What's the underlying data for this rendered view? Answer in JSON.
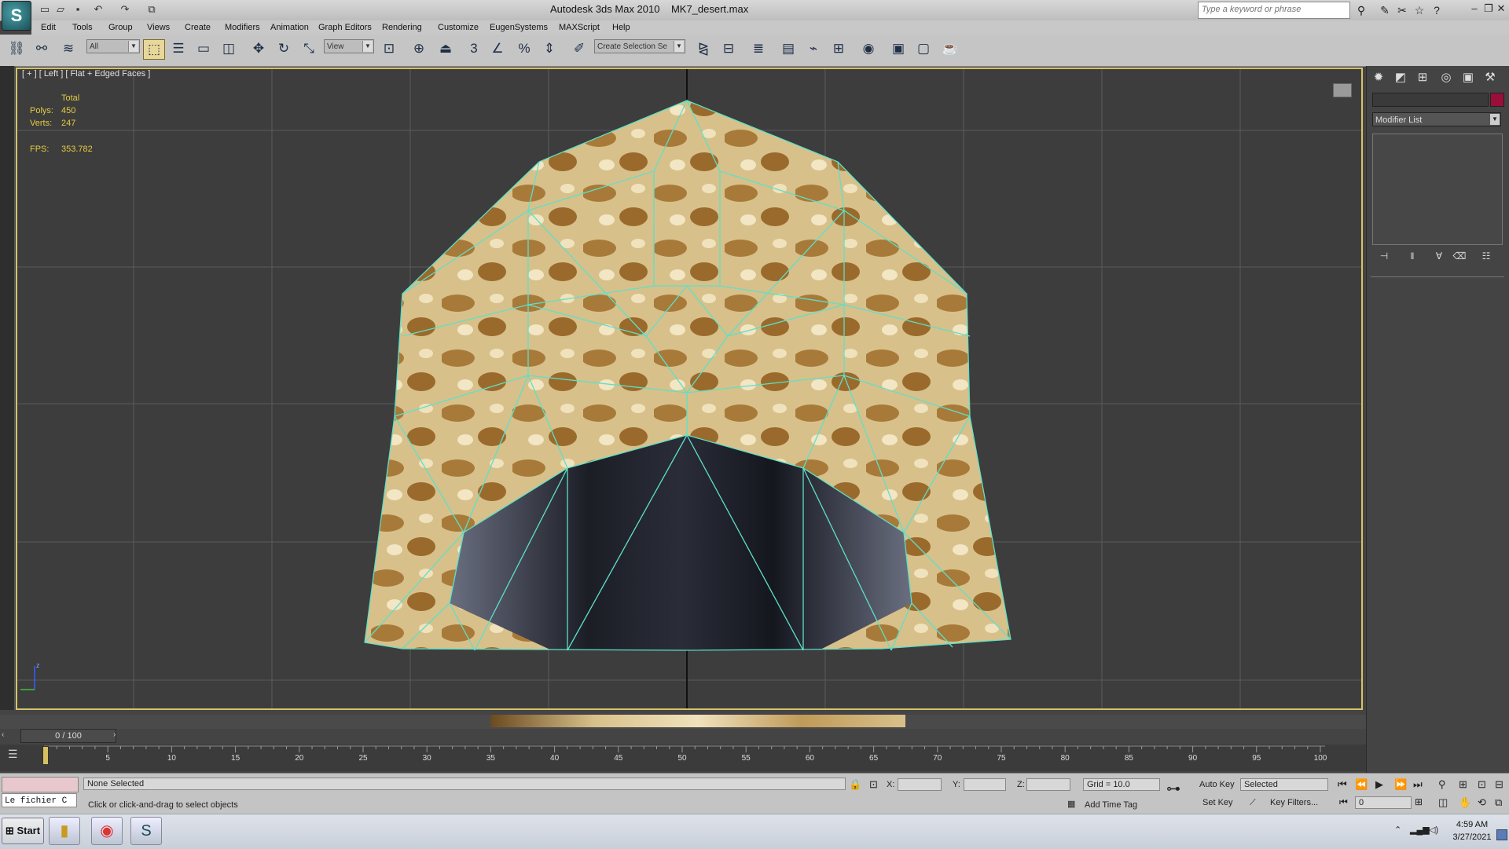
{
  "titlebar": {
    "app_name": "Autodesk 3ds Max  2010",
    "file_name": "MK7_desert.max",
    "search_placeholder": "Type a keyword or phrase"
  },
  "menu": [
    "Edit",
    "Tools",
    "Group",
    "Views",
    "Create",
    "Modifiers",
    "Animation",
    "Graph Editors",
    "Rendering",
    "Customize",
    "EugenSystems",
    "MAXScript",
    "Help"
  ],
  "toolbar": {
    "selection_filter": "All",
    "ref_coord": "View",
    "named_selection": "Create Selection Se",
    "snap_label": "3"
  },
  "viewport": {
    "label": "[ + ] [ Left ] [ Flat + Edged Faces ]",
    "stats_header": "Total",
    "polys_label": "Polys:",
    "polys_value": "450",
    "verts_label": "Verts:",
    "verts_value": "247",
    "fps_label": "FPS:",
    "fps_value": "353.782",
    "axis_z": "z"
  },
  "command_panel": {
    "modifier_list": "Modifier List",
    "object_color": "#9a0e3a"
  },
  "timeline": {
    "time_slider": "0 / 100",
    "ticks": [
      "5",
      "10",
      "15",
      "20",
      "25",
      "30",
      "35",
      "40",
      "45",
      "50",
      "55",
      "60",
      "65",
      "70",
      "75",
      "80",
      "85",
      "90",
      "95",
      "100"
    ]
  },
  "status": {
    "maxscript_listener": "Le fichier C",
    "selection": "None Selected",
    "prompt": "Click or click-and-drag to select objects",
    "x_label": "X:",
    "y_label": "Y:",
    "z_label": "Z:",
    "grid": "Grid = 10.0",
    "add_time_tag": "Add Time Tag",
    "auto_key": "Auto Key",
    "set_key": "Set Key",
    "key_mode": "Selected",
    "key_filters": "Key Filters...",
    "frame": "0"
  },
  "taskbar": {
    "start": "Start",
    "time": "4:59 AM",
    "date": "3/27/2021"
  }
}
